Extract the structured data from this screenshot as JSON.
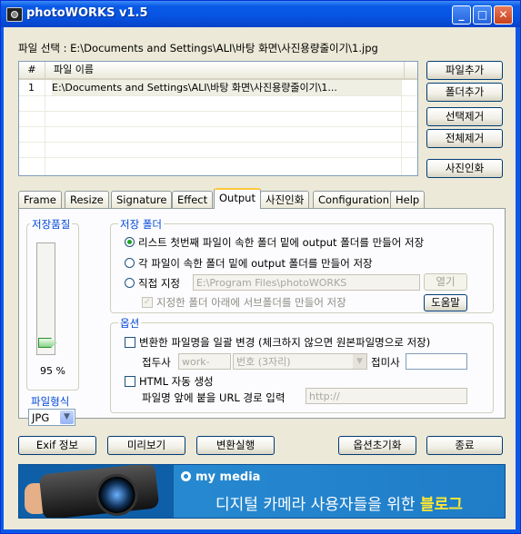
{
  "window": {
    "title": "photoWORKS v1.5"
  },
  "file_select": {
    "label": "파일 선택 : E:\\Documents and Settings\\ALI\\바탕 화면\\사진용량줄이기\\1.jpg"
  },
  "file_list": {
    "columns": [
      "#",
      "파일 이름"
    ],
    "rows": [
      {
        "num": "1",
        "path": "E:\\Documents and Settings\\ALI\\바탕 화면\\사진용량줄이기\\1..."
      }
    ]
  },
  "side_buttons": {
    "add_file": "파일추가",
    "add_folder": "폴더추가",
    "remove_selected": "선택제거",
    "remove_all": "전체제거",
    "print_photo": "사진인화"
  },
  "tabs": [
    "Frame",
    "Resize",
    "Signature",
    "Effect",
    "Output",
    "사진인화",
    "Configuration",
    "Help"
  ],
  "active_tab": "Output",
  "output": {
    "quality": {
      "title": "저장품질",
      "value": 95,
      "value_label": "95 %"
    },
    "file_format": {
      "title": "파일형식",
      "selected": "JPG"
    },
    "save_folder": {
      "title": "저장 폴더",
      "option1": "리스트 첫번째 파일이 속한 폴더 밑에 output  폴더를 만들어 저장",
      "option2": "각 파일이 속한 폴더 밑에 output  폴더를 만들어 저장",
      "option3": "직접 지정",
      "selected_option": 1,
      "path_value": "E:\\Program Files\\photoWORKS",
      "open_button": "열기",
      "subfolder_checkbox": "지정한 폴더 아래에 서브폴더를 만들어 저장",
      "help_button": "도움말"
    },
    "options": {
      "title": "옵션",
      "rename_checkbox": "변환한 파일명을 일괄 변경 (체크하지 않으면 원본파일명으로 저장)",
      "prefix_label": "접두사",
      "prefix_value": "work-",
      "number_select": "번호 (3자리)",
      "suffix_label": "접미사",
      "suffix_value": "",
      "html_checkbox": "HTML 자동 생성",
      "url_label": "파일명 앞에 붙을 URL 경로 입력",
      "url_value": "http://"
    }
  },
  "bottom_buttons": {
    "exif": "Exif 정보",
    "preview": "미리보기",
    "convert": "변환실행",
    "reset_options": "옵션초기화",
    "exit": "종료"
  },
  "banner": {
    "brand": "my media",
    "slogan_main": "디지털 카메라 사용자들을 위한",
    "slogan_highlight": "블로그"
  },
  "colors": {
    "titlebar": "#0653e0",
    "accent_title": "#0046d5",
    "banner": "#2a8fd4",
    "highlight": "#ffe733"
  }
}
